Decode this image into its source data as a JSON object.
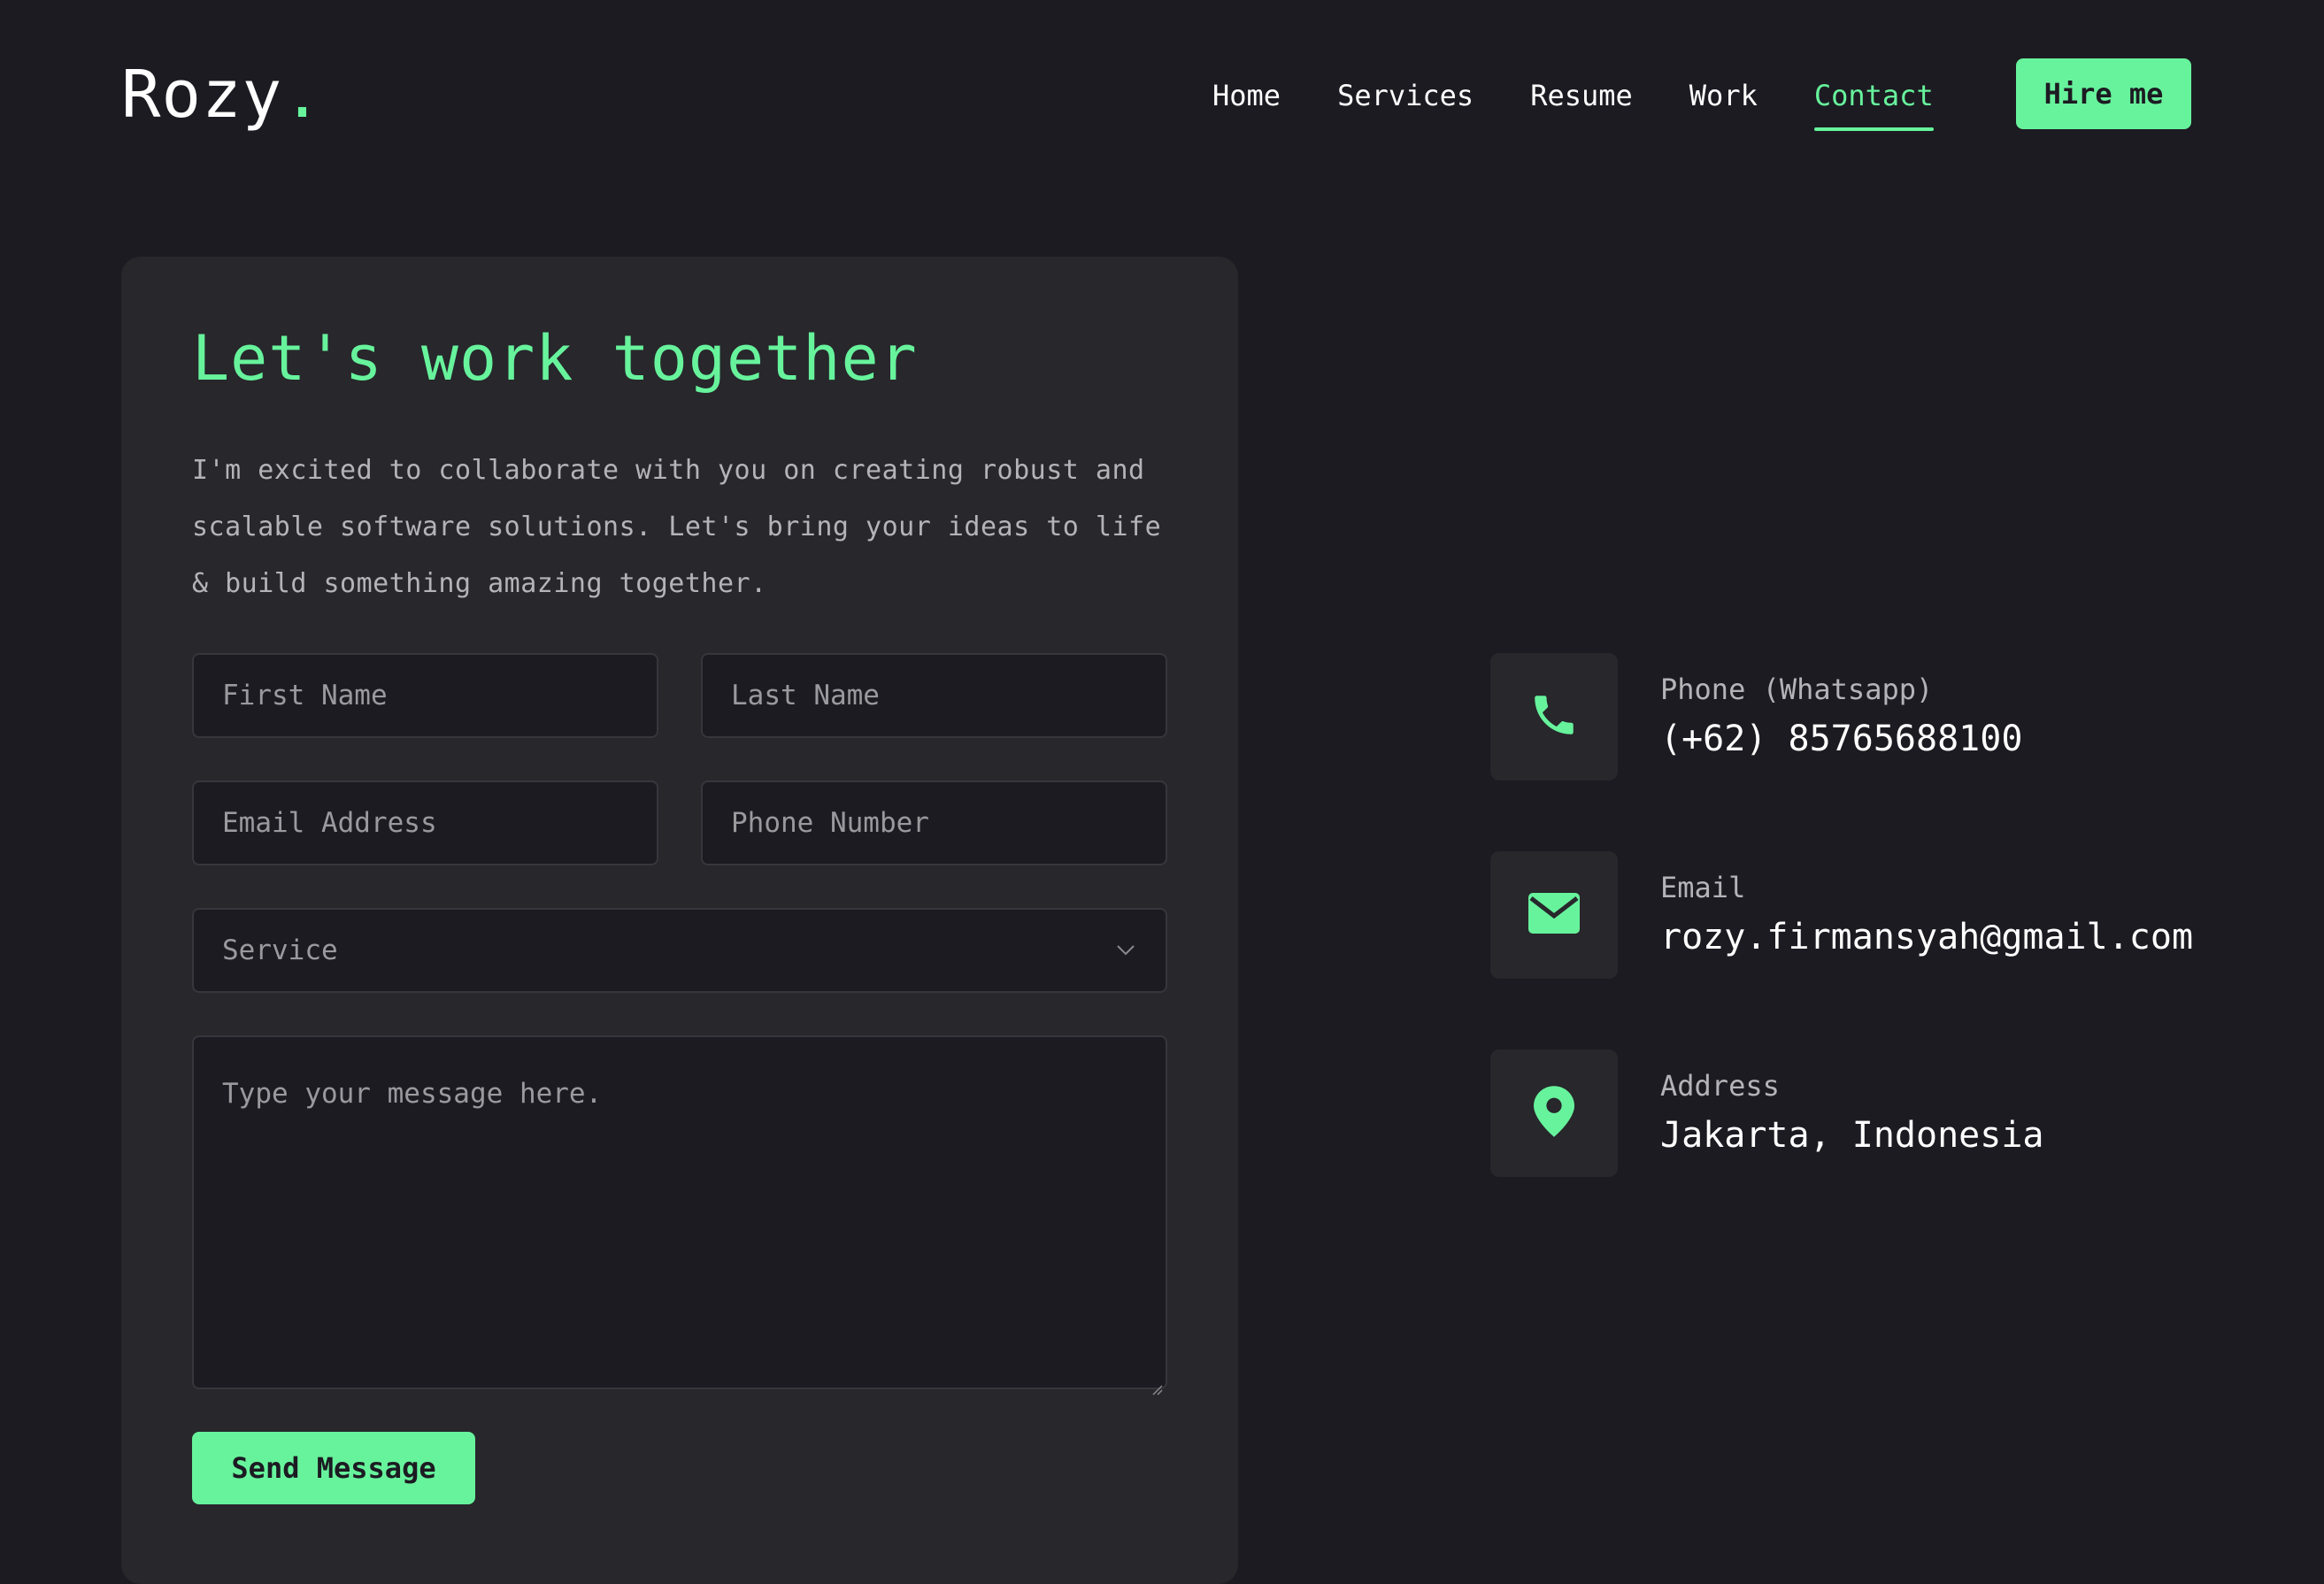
{
  "header": {
    "logo_text": "Rozy",
    "logo_dot": ".",
    "nav": [
      "Home",
      "Services",
      "Resume",
      "Work",
      "Contact"
    ],
    "active_nav": "Contact",
    "hire_label": "Hire me"
  },
  "form": {
    "title": "Let's work together",
    "description": "I'm excited to collaborate with you on creating robust and scalable software solutions. Let's bring your ideas to life & build something amazing together.",
    "first_name_placeholder": "First Name",
    "last_name_placeholder": "Last Name",
    "email_placeholder": "Email Address",
    "phone_placeholder": "Phone Number",
    "service_placeholder": "Service",
    "message_placeholder": "Type your message here.",
    "send_label": "Send Message"
  },
  "contact": [
    {
      "icon": "phone-icon",
      "label": "Phone (Whatsapp)",
      "value": "(+62) 85765688100"
    },
    {
      "icon": "envelope-icon",
      "label": "Email",
      "value": "rozy.firmansyah@gmail.com"
    },
    {
      "icon": "map-pin-icon",
      "label": "Address",
      "value": "Jakarta, Indonesia"
    }
  ],
  "colors": {
    "accent": "#67f39c",
    "background": "#1c1b22",
    "card": "#27272c",
    "muted_text": "#b4b4b8"
  }
}
